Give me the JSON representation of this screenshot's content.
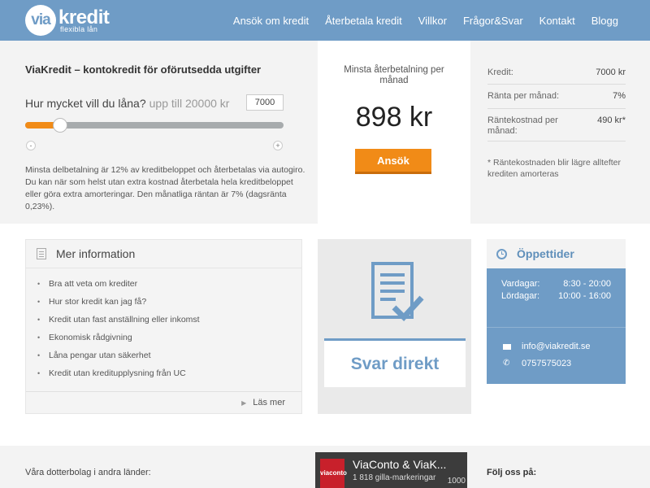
{
  "header": {
    "logo_mark": "via",
    "logo_name": "kredit",
    "logo_tagline": "flexibla lån",
    "nav": [
      "Ansök om kredit",
      "Återbetala kredit",
      "Villkor",
      "Frågor&Svar",
      "Kontakt",
      "Blogg"
    ]
  },
  "calculator": {
    "title": "ViaKredit – kontokredit för oförutsedda utgifter",
    "question": "Hur mycket vill du låna?",
    "max_hint": "upp till 20000 kr",
    "amount_value": "7000",
    "slider_fraction": 0.135,
    "minus_label": "-",
    "plus_label": "+",
    "description": "Minsta delbetalning är 12% av kreditbeloppet och återbetalas via autogiro. Du kan när som helst utan extra kostnad återbetala hela kreditbeloppet eller göra extra amorteringar. Den månatliga räntan är 7% (dagsränta 0,23%).",
    "min_payment_label": "Minsta återbetalning per månad",
    "min_payment_value": "898 kr",
    "apply_label": "Ansök"
  },
  "summary": {
    "rows": [
      {
        "label": "Kredit:",
        "value": "7000 kr"
      },
      {
        "label": "Ränta per månad:",
        "value": "7%"
      },
      {
        "label": "Räntekostnad per månad:",
        "value": "490 kr*"
      }
    ],
    "footnote": "* Räntekostnaden blir lägre alltefter krediten amorteras"
  },
  "info": {
    "title": "Mer information",
    "items": [
      "Bra att veta om krediter",
      "Hur stor kredit kan jag få?",
      "Kredit utan fast anställning eller inkomst",
      "Ekonomisk rådgivning",
      "Låna pengar utan säkerhet",
      "Kredit utan kreditupplysning från UC"
    ],
    "read_more": "Läs mer"
  },
  "svar": {
    "label": "Svar direkt"
  },
  "hours": {
    "title": "Öppettider",
    "rows": [
      {
        "day": "Vardagar:",
        "time": "8:30 - 20:00"
      },
      {
        "day": "Lördagar:",
        "time": "10:00 - 16:00"
      }
    ],
    "email": "info@viakredit.se",
    "phone": "0757575023"
  },
  "footer": {
    "subsidiaries": "Våra dotterbolag i andra länder:",
    "fb_logo": "viaconto",
    "fb_name": "ViaConto & ViaK...",
    "fb_likes": "1 818 gilla-markeringar",
    "fb_count": "1000",
    "follow": "Följ oss på:"
  },
  "colors": {
    "brand_blue": "#6f9cc6",
    "accent_orange": "#f18b17"
  }
}
